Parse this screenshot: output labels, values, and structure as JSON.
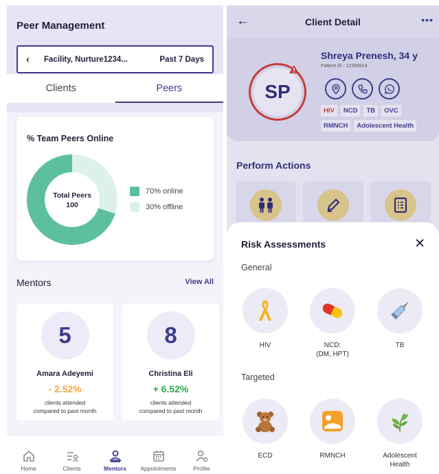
{
  "left": {
    "title": "Peer Management",
    "filter": {
      "facility": "Facility, Nurture1234...",
      "range": "Past 7 Days"
    },
    "tabs": [
      "Clients",
      "Peers"
    ],
    "active_tab": "Peers",
    "online_card": {
      "title": "% Team Peers Online",
      "center_label": "Total Peers",
      "center_value": "100",
      "legend": [
        "70% online",
        "30% offline"
      ]
    },
    "mentors_title": "Mentors",
    "view_all": "View All",
    "mentors": [
      {
        "count": "5",
        "name": "Amara Adeyemi",
        "change": "- 2.52%",
        "note1": "clients attended",
        "note2": "compared to past month"
      },
      {
        "count": "8",
        "name": "Christina Eli",
        "change": "+ 6.52%",
        "note1": "clients attended",
        "note2": "compared to past month"
      }
    ],
    "nav": [
      "Home",
      "Clients",
      "Mentors",
      "Appointments",
      "Profile"
    ],
    "active_nav": "Mentors"
  },
  "chart_data": {
    "type": "pie",
    "title": "% Team Peers Online",
    "categories": [
      "online",
      "offline"
    ],
    "values": [
      70,
      30
    ],
    "colors": [
      "#5cc09f",
      "#dcf1ea"
    ]
  },
  "right": {
    "title": "Client Detail",
    "initials": "SP",
    "client_name": "Shreya Prenesh, 34 y",
    "patient_id": "Patient ID : 12390814",
    "tags": [
      "HIV",
      "NCD",
      "TB",
      "OVC",
      "RMNCH",
      "Adolescent Health"
    ],
    "perform_actions": "Perform Actions",
    "sheet": {
      "title": "Risk Assessments",
      "general_label": "General",
      "targeted_label": "Targeted",
      "general": [
        {
          "line1": "HIV",
          "line2": ""
        },
        {
          "line1": "NCD:",
          "line2": "(DM, HPT)"
        },
        {
          "line1": "TB",
          "line2": ""
        }
      ],
      "targeted": [
        {
          "line1": "ECD",
          "line2": ""
        },
        {
          "line1": "RMNCH",
          "line2": ""
        },
        {
          "line1": "Adolescent",
          "line2": "Health"
        }
      ]
    }
  },
  "colors": {
    "primary": "#3f3d8a",
    "online": "#5cc09f",
    "offline": "#dcf1ea",
    "negative": "#f0a53a",
    "positive": "#2fa84f",
    "alert": "#c63a3a"
  }
}
